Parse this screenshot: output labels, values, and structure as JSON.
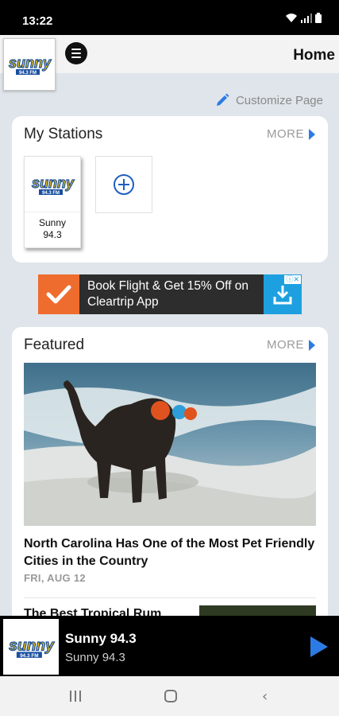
{
  "status_bar": {
    "time": "13:22"
  },
  "header": {
    "title": "Home",
    "logo_text": "sunny",
    "logo_freq": "94.3 FM"
  },
  "customize": {
    "label": "Customize Page"
  },
  "my_stations": {
    "title": "My Stations",
    "more_label": "MORE",
    "stations": [
      {
        "label": "Sunny\n94.3"
      }
    ]
  },
  "ad": {
    "text": "Book Flight & Get 15% Off on Cleartrip App"
  },
  "featured": {
    "title": "Featured",
    "more_label": "MORE",
    "articles": [
      {
        "title": "North Carolina Has One of the Most Pet Friendly Cities in the Country",
        "date": "FRI, AUG 12"
      },
      {
        "title": "The Best Tropical Rum"
      }
    ]
  },
  "player": {
    "title": "Sunny 94.3",
    "subtitle": "Sunny 94.3"
  },
  "colors": {
    "accent": "#2c7be5",
    "logo_yellow": "#f5c400",
    "logo_blue": "#1a4fa0",
    "ad_orange": "#ef6c2f"
  }
}
